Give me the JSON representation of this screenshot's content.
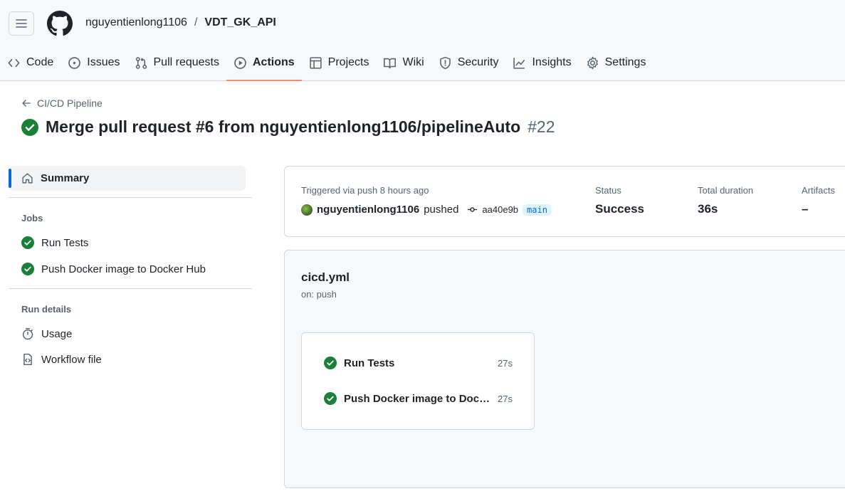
{
  "repo": {
    "owner": "nguyentienlong1106",
    "separator": "/",
    "name": "VDT_GK_API"
  },
  "tabs": [
    {
      "label": "Code",
      "icon": "code-icon"
    },
    {
      "label": "Issues",
      "icon": "issue-icon"
    },
    {
      "label": "Pull requests",
      "icon": "pull-request-icon"
    },
    {
      "label": "Actions",
      "icon": "play-icon",
      "active": true
    },
    {
      "label": "Projects",
      "icon": "table-icon"
    },
    {
      "label": "Wiki",
      "icon": "book-icon"
    },
    {
      "label": "Security",
      "icon": "shield-icon"
    },
    {
      "label": "Insights",
      "icon": "graph-icon"
    },
    {
      "label": "Settings",
      "icon": "gear-icon"
    }
  ],
  "run": {
    "back_label": "CI/CD Pipeline",
    "title": "Merge pull request #6 from nguyentienlong1106/pipelineAuto",
    "number": "#22"
  },
  "sidebar": {
    "summary_label": "Summary",
    "jobs_heading": "Jobs",
    "jobs": [
      "Run Tests",
      "Push Docker image to Docker Hub"
    ],
    "details_heading": "Run details",
    "usage_label": "Usage",
    "workflow_file_label": "Workflow file"
  },
  "summary": {
    "triggered": "Triggered via push 8 hours ago",
    "user": "nguyentienlong1106",
    "action": "pushed",
    "sha": "aa40e9b",
    "branch": "main",
    "status_label": "Status",
    "status_value": "Success",
    "duration_label": "Total duration",
    "duration_value": "36s",
    "artifacts_label": "Artifacts",
    "artifacts_value": "–"
  },
  "workflow": {
    "file": "cicd.yml",
    "trigger": "on: push",
    "jobs": [
      {
        "name": "Run Tests",
        "duration": "27s"
      },
      {
        "name": "Push Docker image to Docker Hub",
        "duration": "27s"
      }
    ]
  },
  "colors": {
    "success": "#1a7f37",
    "accent": "#0969da",
    "active_tab_underline": "#fd8c73"
  }
}
